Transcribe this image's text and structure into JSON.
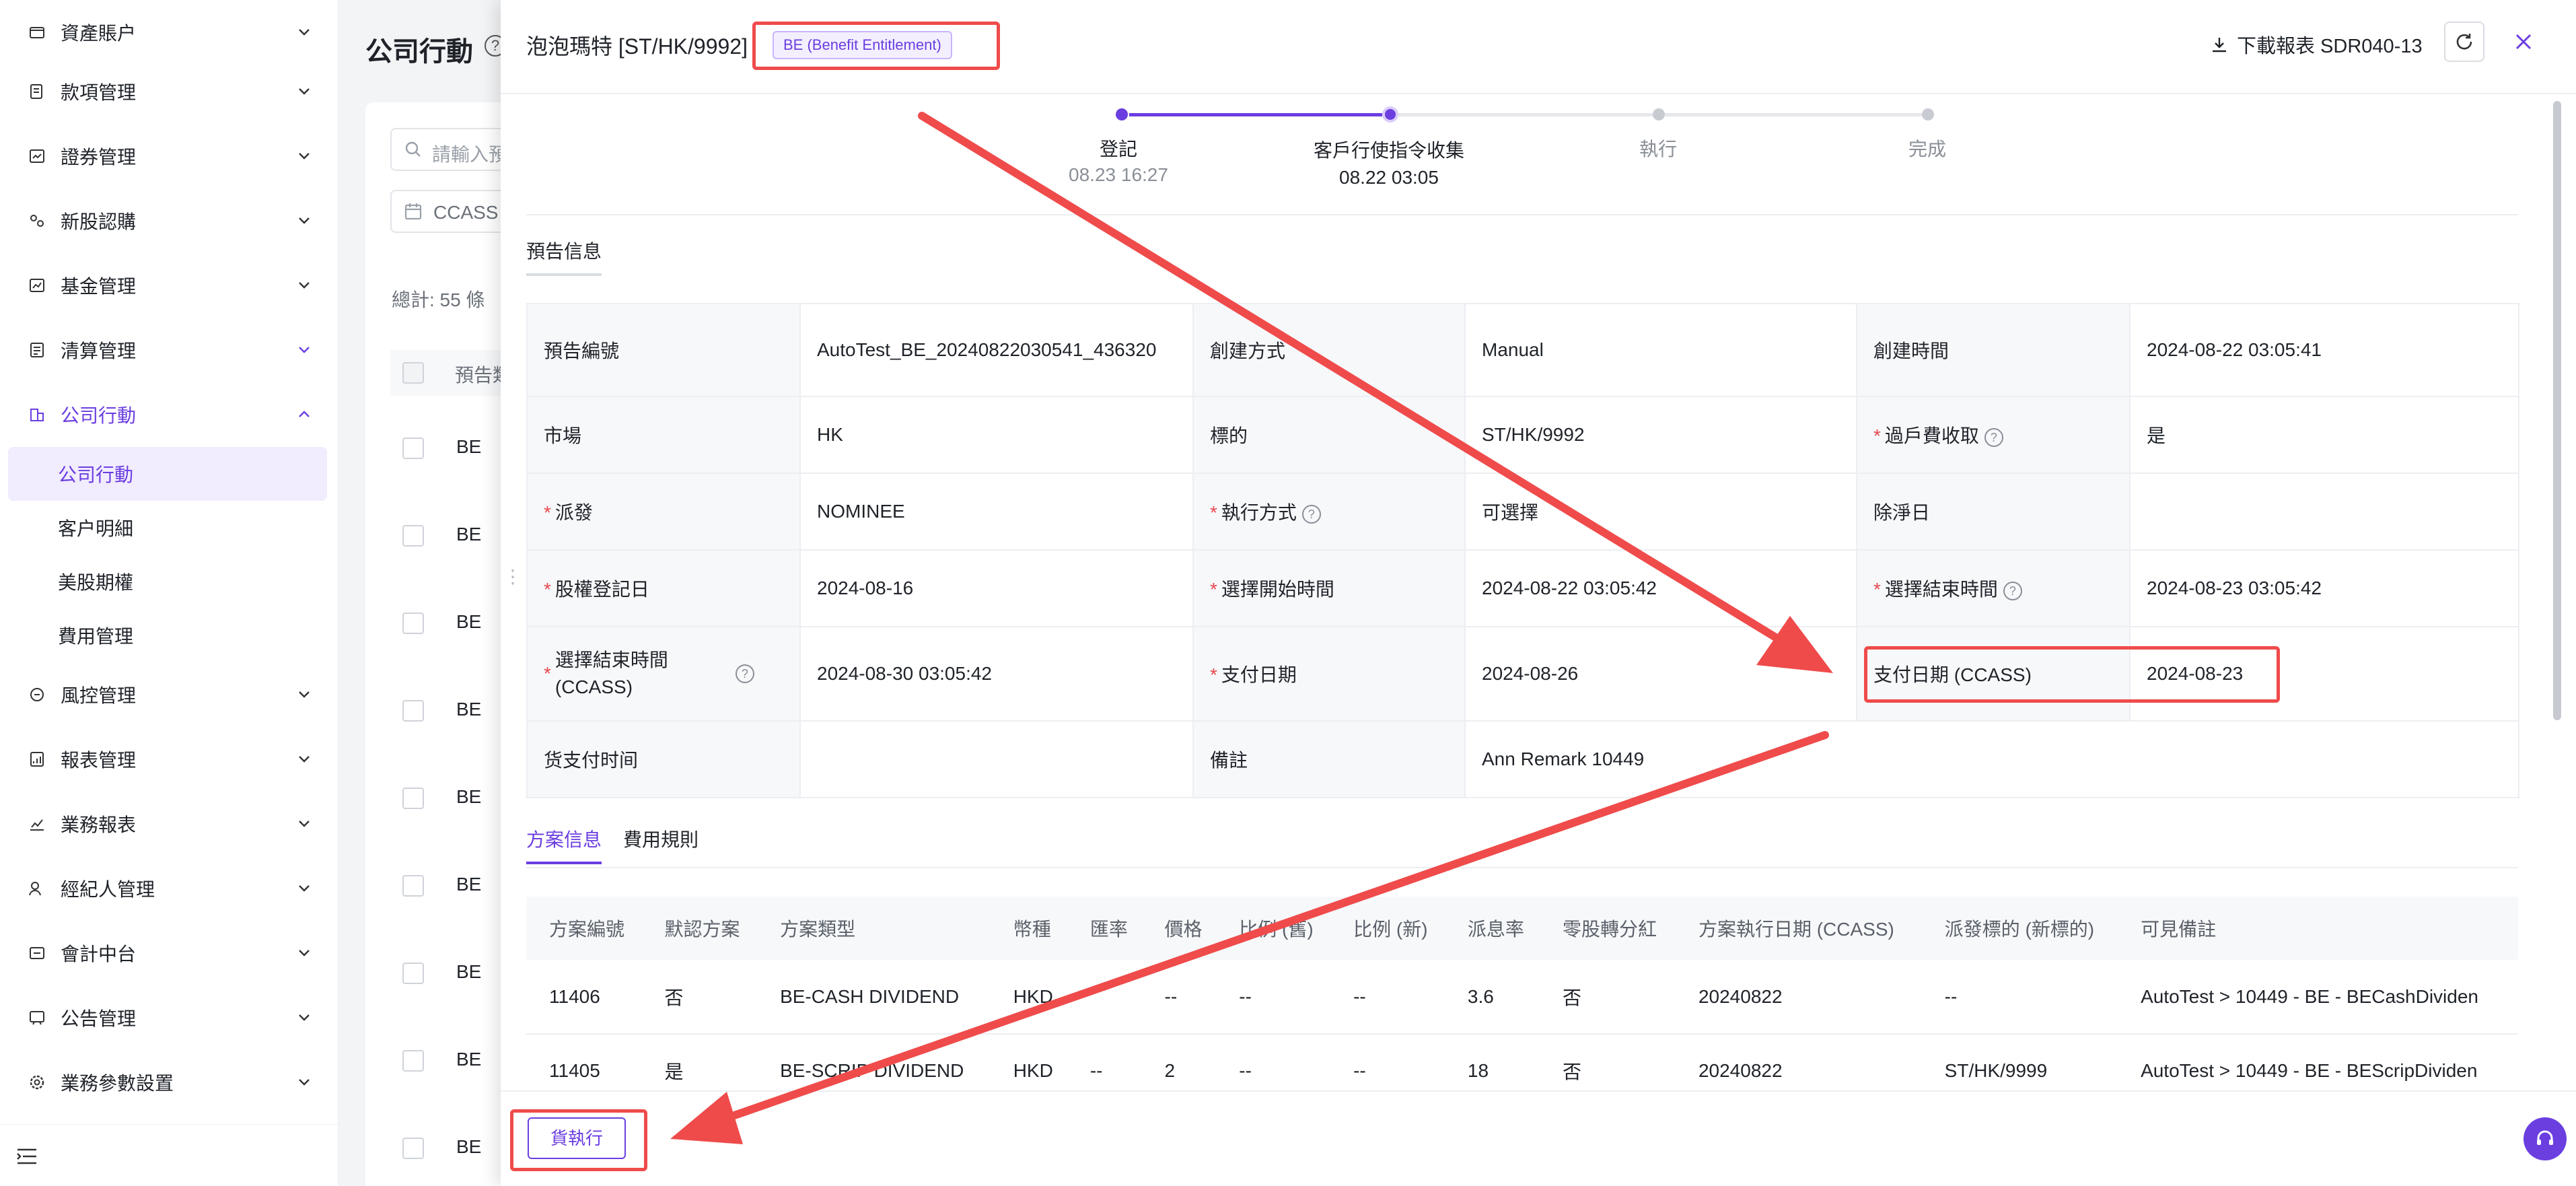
{
  "sidebar": {
    "items": [
      {
        "label": "資產賬户",
        "icon": "wallet-icon"
      },
      {
        "label": "款項管理",
        "icon": "ledger-icon"
      },
      {
        "label": "證券管理",
        "icon": "chart-card-icon"
      },
      {
        "label": "新股認購",
        "icon": "subscribe-icon"
      },
      {
        "label": "基金管理",
        "icon": "fund-icon"
      },
      {
        "label": "清算管理",
        "icon": "clearing-icon"
      },
      {
        "label": "公司行動",
        "icon": "company-icon"
      },
      {
        "label": "風控管理",
        "icon": "risk-icon"
      },
      {
        "label": "報表管理",
        "icon": "report-icon"
      },
      {
        "label": "業務報表",
        "icon": "trend-icon"
      },
      {
        "label": "經紀人管理",
        "icon": "broker-icon"
      },
      {
        "label": "會計中台",
        "icon": "accounting-icon"
      },
      {
        "label": "公告管理",
        "icon": "notice-icon"
      },
      {
        "label": "業務參數設置",
        "icon": "settings-icon"
      }
    ],
    "sub_items": [
      "公司行動",
      "客户明細",
      "美股期權",
      "費用管理"
    ]
  },
  "page": {
    "title": "公司行動",
    "search_placeholder": "請輸入預",
    "date_filter": "CCASS",
    "total": "總計: 55 條",
    "header_label": "預告類",
    "rows": [
      "BE",
      "BE",
      "BE",
      "BE",
      "BE",
      "BE",
      "BE",
      "BE",
      "BE"
    ]
  },
  "drawer": {
    "title": "泡泡瑪特 [ST/HK/9992]",
    "tag": "BE (Benefit Entitlement)",
    "download_label": "下載報表 SDR040-13",
    "steps": [
      {
        "label": "登記",
        "time": "08.23 16:27",
        "state": "done"
      },
      {
        "label": "客戶行使指令收集",
        "time": "08.22 03:05",
        "state": "current"
      },
      {
        "label": "執行",
        "time": "",
        "state": "pending"
      },
      {
        "label": "完成",
        "time": "",
        "state": "pending"
      }
    ],
    "section_tab": "預告信息",
    "info": {
      "notice_no_label": "預告編號",
      "notice_no": "AutoTest_BE_20240822030541_436320",
      "create_method_label": "創建方式",
      "create_method": "Manual",
      "create_time_label": "創建時間",
      "create_time": "2024-08-22 03:05:41",
      "market_label": "市場",
      "market": "HK",
      "underlying_label": "標的",
      "underlying": "ST/HK/9992",
      "transfer_fee_label": "過戶費收取",
      "transfer_fee": "是",
      "distribute_label": "派發",
      "distribute": "NOMINEE",
      "exec_method_label": "執行方式",
      "exec_method": "可選擇",
      "ex_date_label": "除淨日",
      "ex_date": "",
      "record_date_label": "股權登記日",
      "record_date": "2024-08-16",
      "choose_start_label": "選擇開始時間",
      "choose_start": "2024-08-22 03:05:42",
      "choose_end_label": "選擇結束時間",
      "choose_end": "2024-08-23 03:05:42",
      "choose_end_ccass_label": "選擇結束時間 (CCASS)",
      "choose_end_ccass": "2024-08-30 03:05:42",
      "pay_date_label": "支付日期",
      "pay_date": "2024-08-26",
      "pay_date_ccass_label": "支付日期 (CCASS)",
      "pay_date_ccass": "2024-08-23",
      "goods_pay_time_label": "货支付时间",
      "goods_pay_time": "",
      "remark_label": "備註",
      "remark": "Ann Remark 10449"
    },
    "plan_tabs": [
      "方案信息",
      "費用規則"
    ],
    "plan_columns": [
      "方案編號",
      "默認方案",
      "方案類型",
      "幣種",
      "匯率",
      "價格",
      "比例 (舊)",
      "比例 (新)",
      "派息率",
      "零股轉分紅",
      "方案執行日期 (CCASS)",
      "派發標的 (新標的)",
      "可見備註"
    ],
    "plan_rows": [
      [
        "11406",
        "否",
        "BE-CASH DIVIDEND",
        "HKD",
        "",
        "--",
        "--",
        "--",
        "3.6",
        "否",
        "20240822",
        "--",
        "AutoTest > 10449 - BE - BECashDividen"
      ],
      [
        "11405",
        "是",
        "BE-SCRIP DIVIDEND",
        "HKD",
        "--",
        "2",
        "--",
        "--",
        "18",
        "否",
        "20240822",
        "ST/HK/9999",
        "AutoTest > 10449 - BE - BEScripDividen"
      ]
    ],
    "execute_label": "貨執行"
  },
  "colors": {
    "accent": "#6b3ee0",
    "highlight": "#ef4b4b"
  }
}
